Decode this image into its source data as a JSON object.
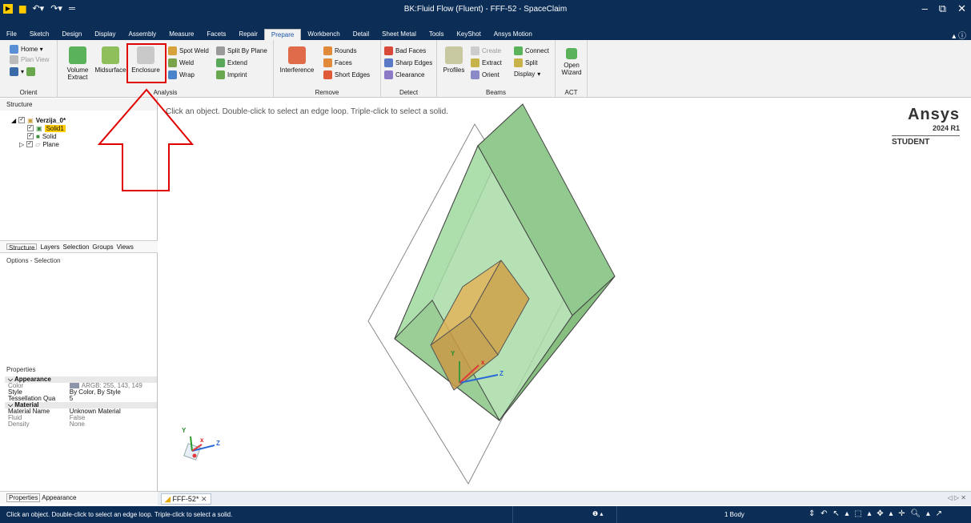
{
  "window": {
    "title": "BK:Fluid Flow (Fluent) - FFF-52 - SpaceClaim",
    "controls": [
      "–",
      "⧉",
      "✕"
    ]
  },
  "menu_tabs": [
    {
      "label": "File",
      "active": false
    },
    {
      "label": "Sketch",
      "active": false
    },
    {
      "label": "Design",
      "active": false
    },
    {
      "label": "Display",
      "active": false
    },
    {
      "label": "Assembly",
      "active": false
    },
    {
      "label": "Measure",
      "active": false
    },
    {
      "label": "Facets",
      "active": false
    },
    {
      "label": "Repair",
      "active": false
    },
    {
      "label": "Prepare",
      "active": true
    },
    {
      "label": "Workbench",
      "active": false
    },
    {
      "label": "Detail",
      "active": false
    },
    {
      "label": "Sheet Metal",
      "active": false
    },
    {
      "label": "Tools",
      "active": false
    },
    {
      "label": "KeyShot",
      "active": false
    },
    {
      "label": "Ansys Motion",
      "active": false
    }
  ],
  "ribbon": {
    "orient": {
      "home": "Home ▾",
      "plan_view": "Plan View",
      "label": "Orient"
    },
    "analysis": {
      "volume_extract": "Volume Extract",
      "midsurface": "Midsurface",
      "enclosure": "Enclosure",
      "spot_weld": "Spot Weld",
      "weld": "Weld",
      "wrap": "Wrap",
      "split_by_plane": "Split By Plane",
      "extend": "Extend",
      "imprint": "Imprint",
      "label": "Analysis"
    },
    "remove": {
      "interference": "Interference",
      "rounds": "Rounds",
      "faces": "Faces",
      "short_edges": "Short Edges",
      "label": "Remove"
    },
    "detect": {
      "bad_faces": "Bad Faces",
      "sharp_edges": "Sharp Edges",
      "clearance": "Clearance",
      "label": "Detect"
    },
    "beams": {
      "profiles": "Profiles",
      "create": "Create",
      "connect": "Connect",
      "extract": "Extract",
      "split": "Split",
      "orient": "Orient",
      "display": "Display",
      "label": "Beams"
    },
    "act": {
      "open_wizard": "Open Wizard",
      "label": "ACT"
    }
  },
  "structure": {
    "header": "Structure",
    "root": "Verzija_0*",
    "items": [
      "Solid1",
      "Solid",
      "Plane"
    ]
  },
  "panel_tabs": [
    "Structure",
    "Layers",
    "Selection",
    "Groups",
    "Views"
  ],
  "options_header": "Options - Selection",
  "properties": {
    "header": "Properties",
    "rows": [
      {
        "k": "Appearance",
        "v": "",
        "type": "hdr"
      },
      {
        "k": "Color",
        "v": "ARGB: 255, 143, 149",
        "type": "dim"
      },
      {
        "k": "Style",
        "v": "By Color, By Style",
        "type": ""
      },
      {
        "k": "Tessellation Qua",
        "v": "5",
        "type": ""
      },
      {
        "k": "Material",
        "v": "",
        "type": "hdr"
      },
      {
        "k": "Material Name",
        "v": "Unknown Material",
        "type": ""
      },
      {
        "k": "Fluid",
        "v": "False",
        "type": "dim"
      },
      {
        "k": "Density",
        "v": "None",
        "type": "dim"
      }
    ],
    "tabs": [
      "Properties",
      "Appearance"
    ]
  },
  "viewport": {
    "hint": "Click an object. Double-click to select an edge loop. Triple-click to select a solid.",
    "brand_name": "Ansys",
    "brand_version": "2024 R1",
    "brand_edition": "STUDENT",
    "axis_labels": {
      "x": "x",
      "y": "Y",
      "z": "Z"
    }
  },
  "document_tab": "FFF-52*",
  "status": {
    "message": "Click an object. Double-click to select an edge loop. Triple-click to select a solid.",
    "info": "❶ ▴",
    "selection": "1 Body",
    "tools": "⇕ ↶ ↖ ▴ ⬚ ▴ ✥ ▴ ✛ 🔍︎ ▴ ↗"
  },
  "colors": {
    "title_bg": "#0b2d56",
    "accent": "#1a56a8",
    "highlight": "#e00000",
    "selection": "#ffcc00"
  }
}
